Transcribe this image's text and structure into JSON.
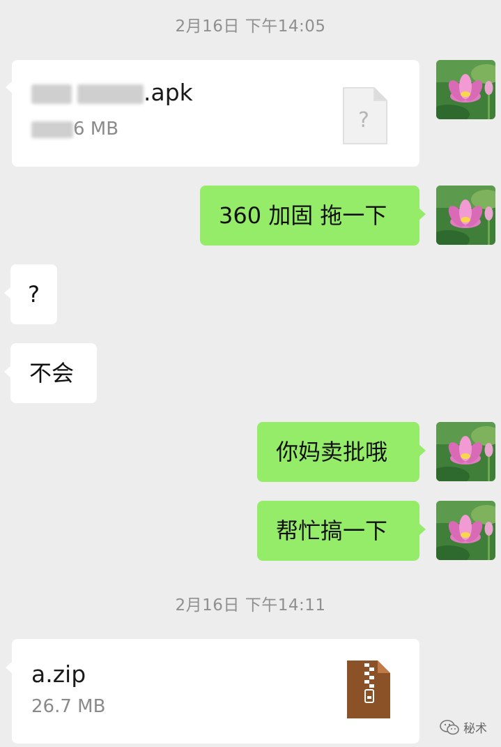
{
  "timestamps": [
    "2月16日 下午14:05",
    "2月16日 下午14:11"
  ],
  "messages": {
    "apk_file": {
      "name_suffix": ".apk",
      "size_suffix": "6 MB",
      "icon": "unknown-file-icon",
      "icon_glyph": "?"
    },
    "m1": "360 加固 拖一下",
    "m2": "?",
    "m3": "不会",
    "m4": "你妈卖批哦",
    "m5": "帮忙搞一下",
    "zip_file": {
      "name": "a.zip",
      "size": "26.7 MB",
      "icon": "zip-archive-icon"
    }
  },
  "watermark": {
    "text": "秘术",
    "icon": "wechat-official-account-icon"
  },
  "colors": {
    "background": "#ededed",
    "sent_bubble": "#95ec69",
    "received_bubble": "#ffffff",
    "zip_icon": "#8b5127"
  }
}
